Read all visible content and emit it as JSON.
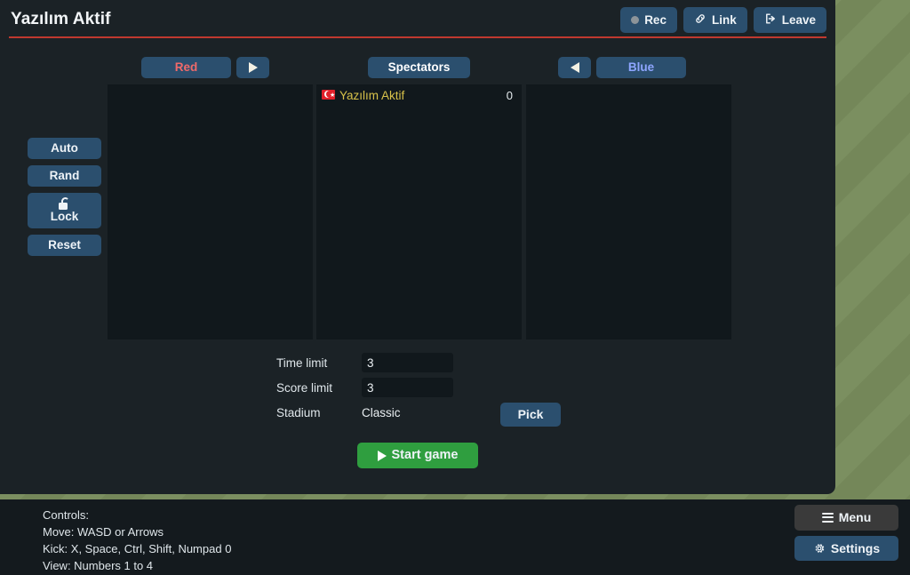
{
  "room": {
    "title": "Yazılım Aktif",
    "accent_rule_color": "#c0392f"
  },
  "header_buttons": [
    {
      "label": "Rec",
      "icon": "record-dot-icon"
    },
    {
      "label": "Link",
      "icon": "link-icon"
    },
    {
      "label": "Leave",
      "icon": "sign-out-icon"
    }
  ],
  "teams": {
    "red": {
      "label": "Red",
      "move_arrow": "arrow-right-icon"
    },
    "spec": {
      "label": "Spectators"
    },
    "blue": {
      "label": "Blue",
      "move_arrow": "arrow-left-icon"
    }
  },
  "player_lists": {
    "red": [],
    "spectators": [
      {
        "flag": "TR",
        "name": "Yazılım Aktif",
        "ping": "0"
      }
    ],
    "blue": []
  },
  "side_controls": [
    {
      "label": "Auto",
      "icon": ""
    },
    {
      "label": "Rand",
      "icon": ""
    },
    {
      "label": "Lock",
      "icon": "unlocked-padlock-icon"
    },
    {
      "label": "Reset",
      "icon": ""
    }
  ],
  "match_settings": {
    "time_limit": {
      "label": "Time limit",
      "value": "3"
    },
    "score_limit": {
      "label": "Score limit",
      "value": "3"
    },
    "stadium": {
      "label": "Stadium",
      "value": "Classic",
      "pick_label": "Pick"
    }
  },
  "start_button": {
    "label": "Start game",
    "icon": "play-triangle-icon",
    "color": "#2f9e3f"
  },
  "bottom": {
    "controls_help": "Controls:\nMove: WASD or Arrows\nKick: X, Space, Ctrl, Shift, Numpad 0\nView: Numbers 1 to 4",
    "menu_label": "Menu",
    "settings_label": "Settings"
  }
}
